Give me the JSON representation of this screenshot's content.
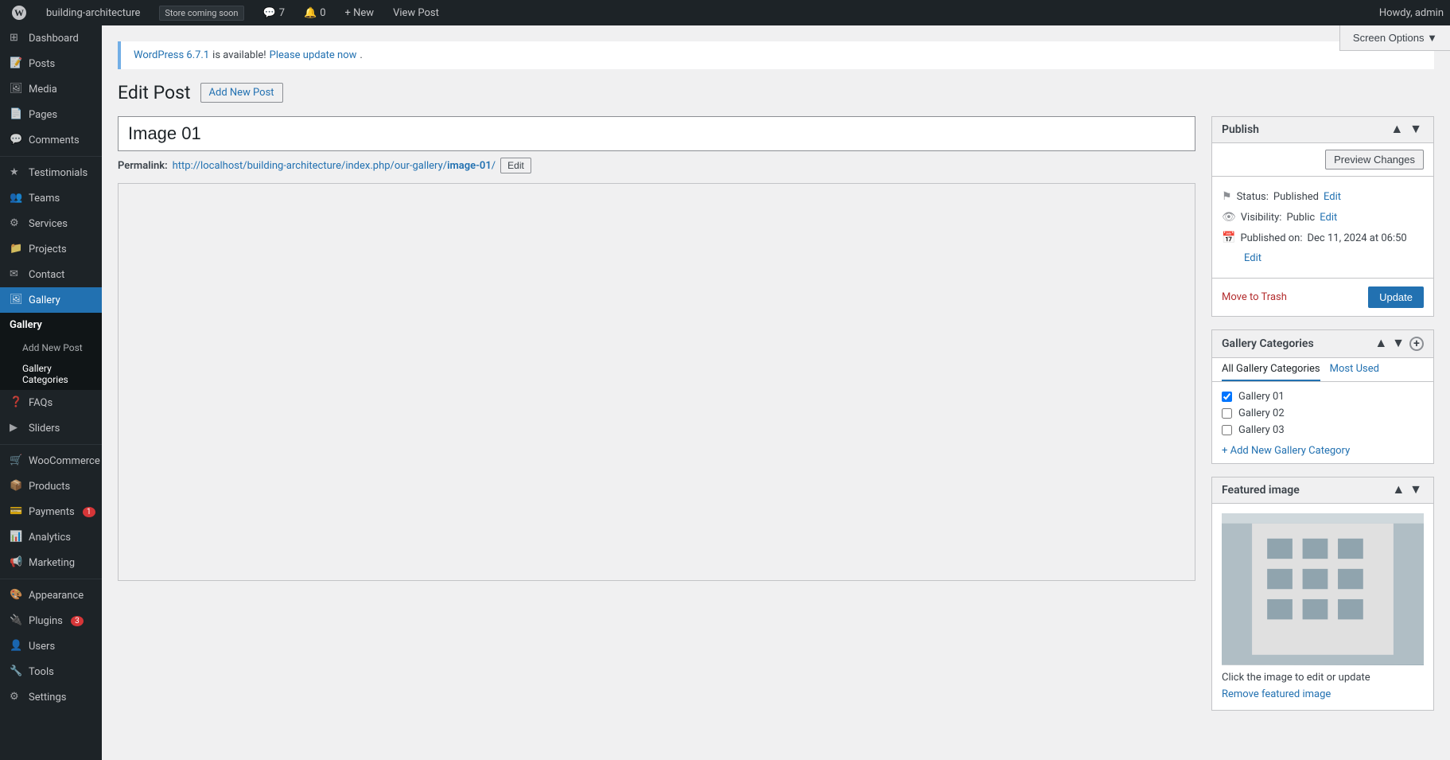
{
  "adminbar": {
    "wp_logo": "●",
    "site_name": "building-architecture",
    "store_badge": "Store coming soon",
    "comments_count": "7",
    "notif_count": "0",
    "new_label": "+ New",
    "view_post_label": "View Post",
    "howdy": "Howdy, admin"
  },
  "sidebar": {
    "items": [
      {
        "id": "dashboard",
        "label": "Dashboard",
        "icon": "⊞"
      },
      {
        "id": "posts",
        "label": "Posts",
        "icon": "📄"
      },
      {
        "id": "media",
        "label": "Media",
        "icon": "🖼"
      },
      {
        "id": "pages",
        "label": "Pages",
        "icon": "📃"
      },
      {
        "id": "comments",
        "label": "Comments",
        "icon": "💬"
      },
      {
        "id": "testimonials",
        "label": "Testimonials",
        "icon": "★"
      },
      {
        "id": "teams",
        "label": "Teams",
        "icon": "👥"
      },
      {
        "id": "services",
        "label": "Services",
        "icon": "⚙"
      },
      {
        "id": "projects",
        "label": "Projects",
        "icon": "📁"
      },
      {
        "id": "contact",
        "label": "Contact",
        "icon": "✉"
      },
      {
        "id": "gallery",
        "label": "Gallery",
        "icon": "🖼",
        "active": true
      },
      {
        "id": "faqs",
        "label": "FAQs",
        "icon": "❓"
      },
      {
        "id": "sliders",
        "label": "Sliders",
        "icon": "▶"
      },
      {
        "id": "woocommerce",
        "label": "WooCommerce",
        "icon": "🛒"
      },
      {
        "id": "products",
        "label": "Products",
        "icon": "📦"
      },
      {
        "id": "payments",
        "label": "Payments",
        "icon": "💳",
        "badge": "1"
      },
      {
        "id": "analytics",
        "label": "Analytics",
        "icon": "📊"
      },
      {
        "id": "marketing",
        "label": "Marketing",
        "icon": "📢"
      },
      {
        "id": "appearance",
        "label": "Appearance",
        "icon": "🎨"
      },
      {
        "id": "plugins",
        "label": "Plugins",
        "icon": "🔌",
        "badge": "3"
      },
      {
        "id": "users",
        "label": "Users",
        "icon": "👤"
      },
      {
        "id": "tools",
        "label": "Tools",
        "icon": "🔧"
      },
      {
        "id": "settings",
        "label": "Settings",
        "icon": "⚙"
      }
    ],
    "submenu": {
      "header": "Gallery",
      "items": [
        {
          "id": "add-new-post",
          "label": "Add New Post"
        },
        {
          "id": "gallery-categories",
          "label": "Gallery Categories"
        }
      ]
    }
  },
  "screen_options": {
    "label": "Screen Options ▼"
  },
  "notice": {
    "link_text": "WordPress 6.7.1",
    "text": " is available! ",
    "update_link": "Please update now"
  },
  "page": {
    "title": "Edit Post",
    "add_new_label": "Add New Post"
  },
  "post": {
    "title": "Image 01",
    "permalink_label": "Permalink:",
    "permalink_url": "http://localhost/building-architecture/index.php/our-gallery/",
    "permalink_bold": "image-01",
    "permalink_slash": "/",
    "permalink_edit": "Edit"
  },
  "publish_box": {
    "title": "Publish",
    "preview_btn": "Preview Changes",
    "status_label": "Status:",
    "status_value": "Published",
    "status_edit": "Edit",
    "visibility_label": "Visibility:",
    "visibility_value": "Public",
    "visibility_edit": "Edit",
    "published_label": "Published on:",
    "published_value": "Dec 11, 2024 at 06:50",
    "published_edit": "Edit",
    "move_to_trash": "Move to Trash",
    "update_btn": "Update"
  },
  "gallery_categories_box": {
    "title": "Gallery Categories",
    "tabs": [
      {
        "id": "all",
        "label": "All Gallery Categories",
        "active": false
      },
      {
        "id": "most-used",
        "label": "Most Used",
        "active": false
      }
    ],
    "categories": [
      {
        "id": "gallery-01",
        "label": "Gallery 01",
        "checked": true
      },
      {
        "id": "gallery-02",
        "label": "Gallery 02",
        "checked": false
      },
      {
        "id": "gallery-03",
        "label": "Gallery 03",
        "checked": false
      }
    ],
    "add_link": "+ Add New Gallery Category"
  },
  "featured_image_box": {
    "title": "Featured image",
    "caption": "Click the image to edit or update",
    "remove_link": "Remove featured image"
  }
}
